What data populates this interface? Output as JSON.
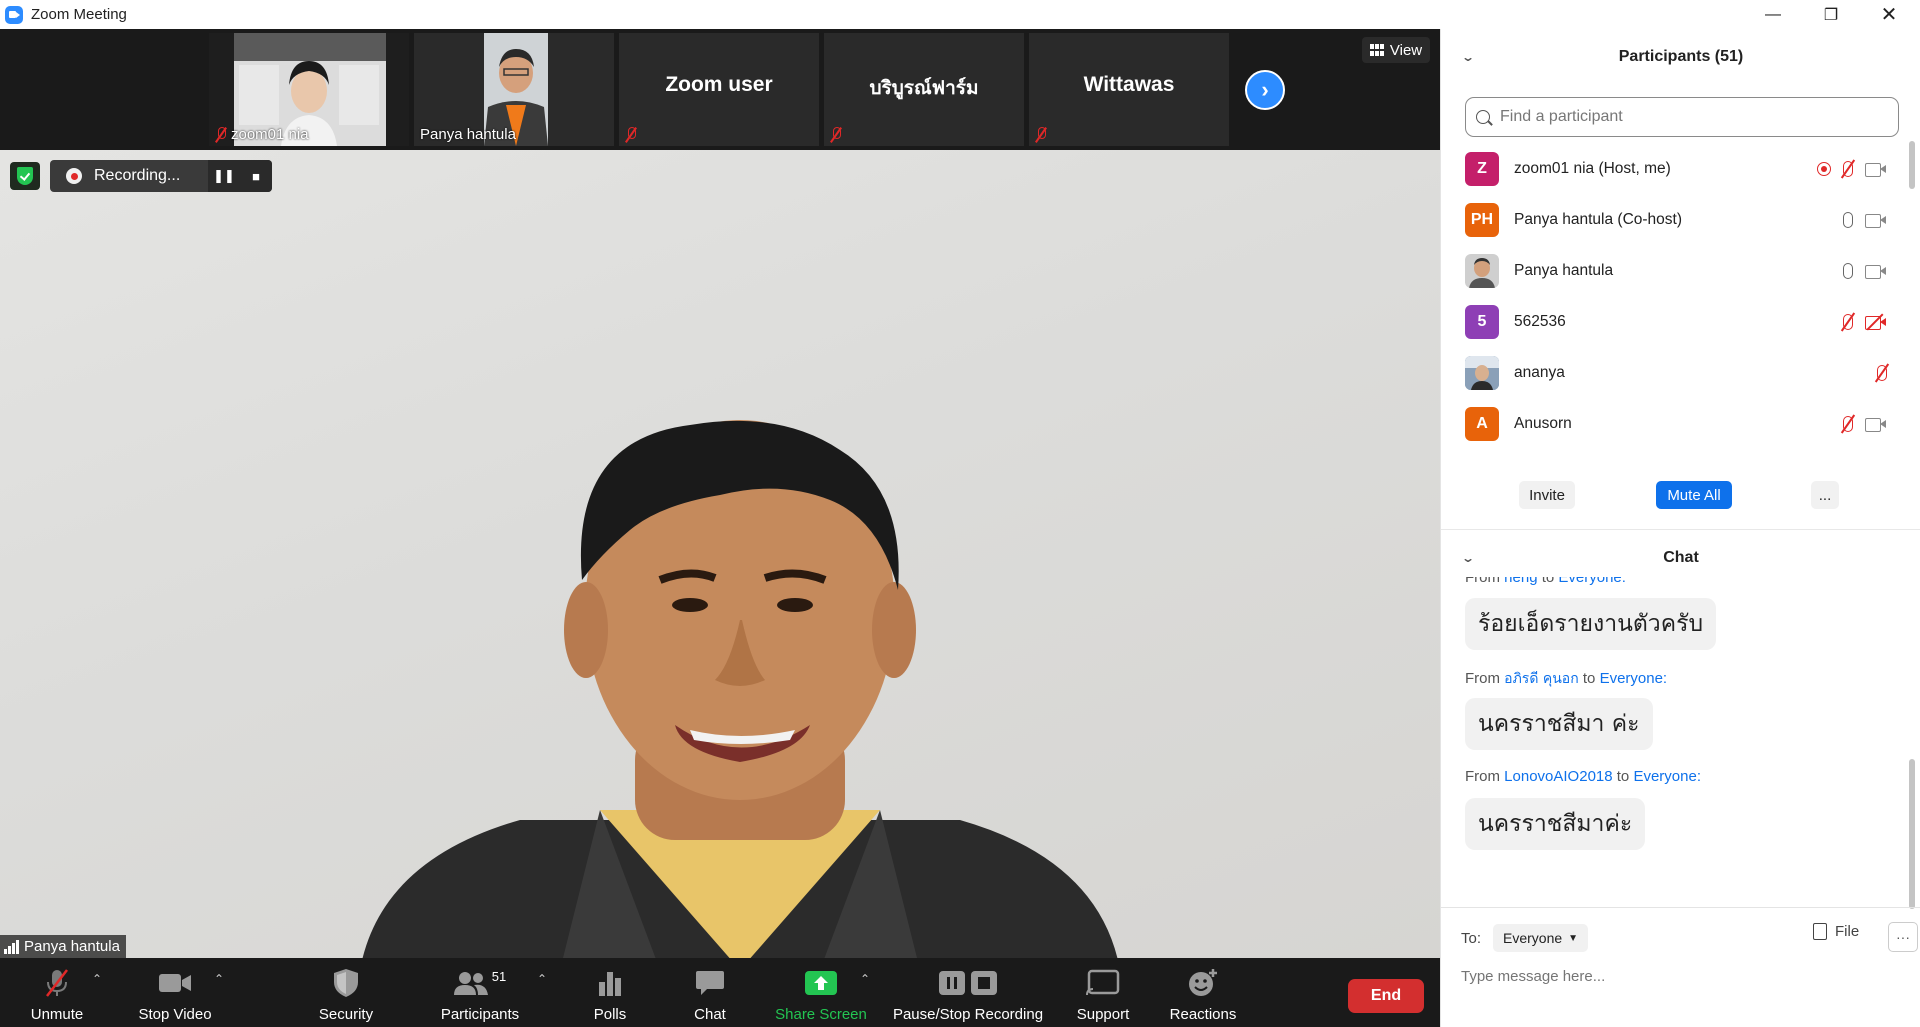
{
  "window": {
    "title": "Zoom Meeting"
  },
  "filmstrip": {
    "tiles": [
      {
        "name": "zoom01 nia"
      },
      {
        "name": "Panya hantula"
      },
      {
        "name": "Zoom user"
      },
      {
        "name": "บริบูรณ์ฟาร์ม"
      },
      {
        "name": "Wittawas"
      }
    ],
    "view_label": "View"
  },
  "main_video": {
    "recording_label": "Recording...",
    "speaker_name": "Panya hantula"
  },
  "toolbar": {
    "unmute": "Unmute",
    "stop_video": "Stop Video",
    "security": "Security",
    "participants": "Participants",
    "participants_count": "51",
    "polls": "Polls",
    "chat": "Chat",
    "share_screen": "Share Screen",
    "pause_stop_recording": "Pause/Stop Recording",
    "support": "Support",
    "reactions": "Reactions",
    "end": "End"
  },
  "participants_panel": {
    "title": "Participants (51)",
    "search_placeholder": "Find a participant",
    "participants": [
      {
        "initials": "Z",
        "color": "#c41f6a",
        "name": "zoom01 nia (Host, me)",
        "mic": "off",
        "cam": "on",
        "recording": true
      },
      {
        "initials": "PH",
        "color": "#e8630a",
        "name": "Panya hantula (Co-host)",
        "mic": "on",
        "cam": "on",
        "recording": false
      },
      {
        "initials": "",
        "color": "#9a8a7a",
        "name": "Panya hantula",
        "mic": "on",
        "cam": "on",
        "recording": false,
        "photo": true
      },
      {
        "initials": "5",
        "color": "#8e3fb5",
        "name": "562536",
        "mic": "off",
        "cam": "off",
        "recording": false
      },
      {
        "initials": "",
        "color": "#6c8aa8",
        "name": "ananya",
        "mic": "off",
        "cam": "none",
        "recording": false,
        "photo": true
      },
      {
        "initials": "A",
        "color": "#e8630a",
        "name": "Anusorn",
        "mic": "off",
        "cam": "on",
        "recording": false
      }
    ],
    "invite": "Invite",
    "mute_all": "Mute All",
    "more": "..."
  },
  "chat_panel": {
    "title": "Chat",
    "from_word": "From",
    "to_word": "to",
    "messages": [
      {
        "from": "heng",
        "to": "Everyone:",
        "text": "ร้อยเอ็ดรายงานตัวครับ"
      },
      {
        "from": "อภิรดี คุนอก",
        "to": "Everyone:",
        "text": "นครราชสีมา ค่ะ"
      },
      {
        "from": "LonovoAIO2018",
        "to": "Everyone:",
        "text": "นครราชสีมาค่ะ"
      }
    ],
    "to_label": "To:",
    "to_value": "Everyone",
    "file_label": "File",
    "more_label": "···",
    "input_placeholder": "Type message here..."
  },
  "colors": {
    "accent_blue": "#2D8CFF",
    "end_red": "#d32f2f",
    "share_green": "#23c552",
    "mute_red": "#e02828"
  }
}
